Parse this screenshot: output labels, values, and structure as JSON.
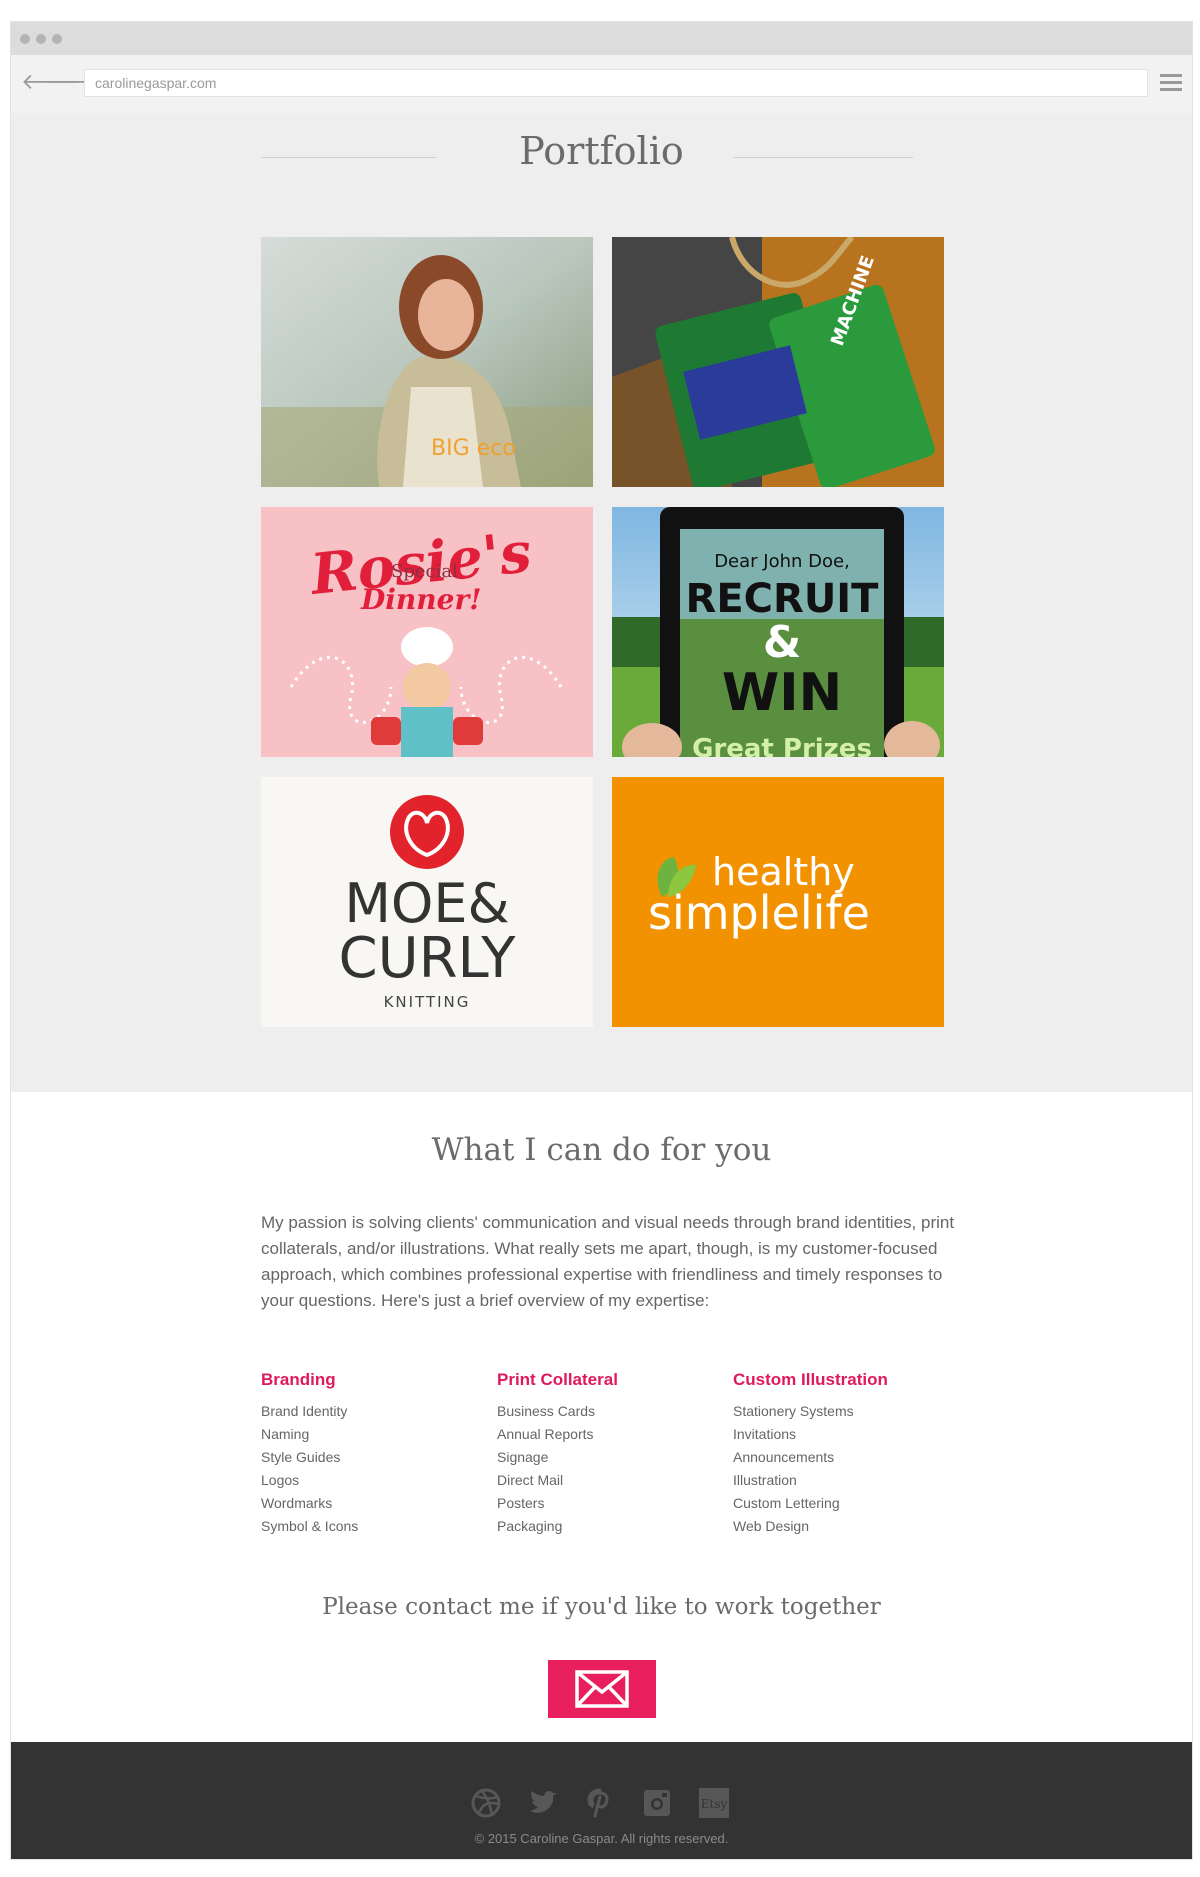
{
  "browser": {
    "url": "carolinegaspar.com",
    "back_glyph": "🡐",
    "forward_glyph": "🡒"
  },
  "portfolio": {
    "heading": "Portfolio",
    "tiles": [
      {
        "name": "big-eco-gardenmasters",
        "logo_text": "BIG eco"
      },
      {
        "name": "machine-hang-tag",
        "logo_text": "MACHINE"
      },
      {
        "name": "rosies-special-dinner",
        "title": "Rosie's",
        "subtitle": "Special",
        "title2": "Dinner!"
      },
      {
        "name": "recruit-and-win",
        "line1": "Dear John Doe,",
        "line2": "RECRUIT",
        "line3": "&",
        "line4": "WIN",
        "line5": "Great Prizes"
      },
      {
        "name": "moe-and-curly",
        "line1": "MOE&",
        "line2": "CURLY",
        "line3": "KNITTING"
      },
      {
        "name": "healthy-simple-life",
        "line1": "healthy",
        "line2": "simplelife"
      }
    ]
  },
  "services": {
    "heading": "What I can do for you",
    "intro": "My passion is solving clients' communication and visual needs through brand identities, print collaterals, and/or illustrations. What really sets me apart, though, is my customer-focused approach, which combines professional expertise with friendliness and timely responses to your questions. Here's just a brief overview of my expertise:",
    "columns": [
      {
        "title": "Branding",
        "items": [
          "Brand Identity",
          "Naming",
          "Style Guides",
          "Logos",
          "Wordmarks",
          "Symbol & Icons"
        ]
      },
      {
        "title": "Print Collateral",
        "items": [
          "Business Cards",
          "Annual Reports",
          "Signage",
          "Direct Mail",
          "Posters",
          "Packaging"
        ]
      },
      {
        "title": "Custom Illustration",
        "items": [
          "Stationery Systems",
          "Invitations",
          "Announcements",
          "Illustration",
          "Custom Lettering",
          "Web Design"
        ]
      }
    ],
    "contact_text": "Please contact me if you'd like to work together"
  },
  "footer": {
    "social_icons": [
      "dribbble-icon",
      "twitter-icon",
      "pinterest-icon",
      "instagram-icon",
      "etsy-icon"
    ],
    "etsy_label": "Etsy",
    "copyright": "© 2015 Caroline Gaspar. All rights reserved."
  },
  "colors": {
    "accent": "#e81f5c",
    "heading_pink": "#e01a5a",
    "portfolio_bg": "#eeeeee",
    "footer_bg": "#333333",
    "orange": "#f39200"
  }
}
